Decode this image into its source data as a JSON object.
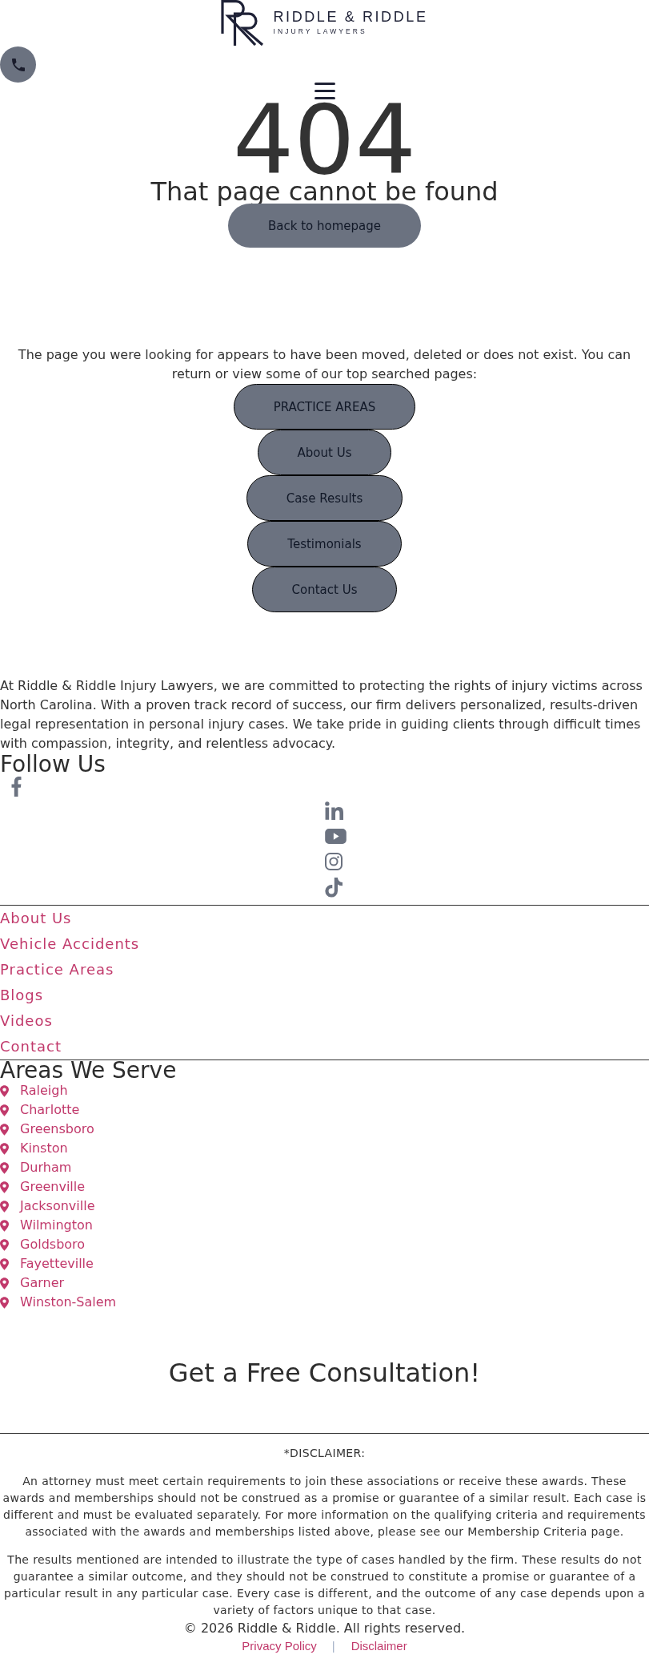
{
  "header": {
    "logo": {
      "name": "RIDDLE & RIDDLE",
      "tagline": "INJURY LAWYERS"
    }
  },
  "error": {
    "code": "404",
    "heading": "That page cannot be found",
    "button": "Back to homepage"
  },
  "top_pages": {
    "intro": "The page you were looking for appears to have been moved, deleted or does not exist. You can return or view some of our top searched pages:",
    "links": [
      "PRACTICE AREAS",
      "About Us",
      "Case Results",
      "Testimonials",
      "Contact Us"
    ]
  },
  "about": {
    "text": "At Riddle & Riddle Injury Lawyers, we are committed to protecting the rights of injury victims across North Carolina. With a proven track record of success, our firm delivers personalized, results-driven legal representation in personal injury cases. We take pride in guiding clients through difficult times with compassion, integrity, and relentless advocacy."
  },
  "follow_us": {
    "title": "Follow Us"
  },
  "footer_nav": [
    "About Us",
    "Vehicle Accidents",
    "Practice Areas",
    "Blogs",
    "Videos",
    "Contact"
  ],
  "areas": {
    "title": "Areas We Serve",
    "cities": [
      "Raleigh",
      "Charlotte",
      "Greensboro",
      "Kinston",
      "Durham",
      "Greenville",
      "Jacksonville",
      "Wilmington",
      "Goldsboro",
      "Fayetteville",
      "Garner",
      "Winston-Salem"
    ]
  },
  "consultation": {
    "title": "Get a Free Consultation!"
  },
  "disclaimer": {
    "label": "*DISCLAIMER:",
    "paragraphs": [
      "An attorney must meet certain requirements to join these associations or receive these awards. These awards and memberships should not be construed as a promise or guarantee of a similar result. Each case is different and must be evaluated separately. For more information on the qualifying criteria and requirements associated with the awards and memberships listed above, please see our Membership Criteria page.",
      "The results mentioned are intended to illustrate the type of cases handled by the firm. These results do not guarantee a similar outcome, and they should not be construed to constitute a promise or guarantee of a particular result in any particular case. Every case is different, and the outcome of any case depends upon a variety of factors unique to that case."
    ]
  },
  "footer": {
    "copyright": "© 2026 Riddle & Riddle. All rights reserved.",
    "links": [
      "Privacy Policy",
      "Disclaimer"
    ],
    "separator": "|"
  }
}
